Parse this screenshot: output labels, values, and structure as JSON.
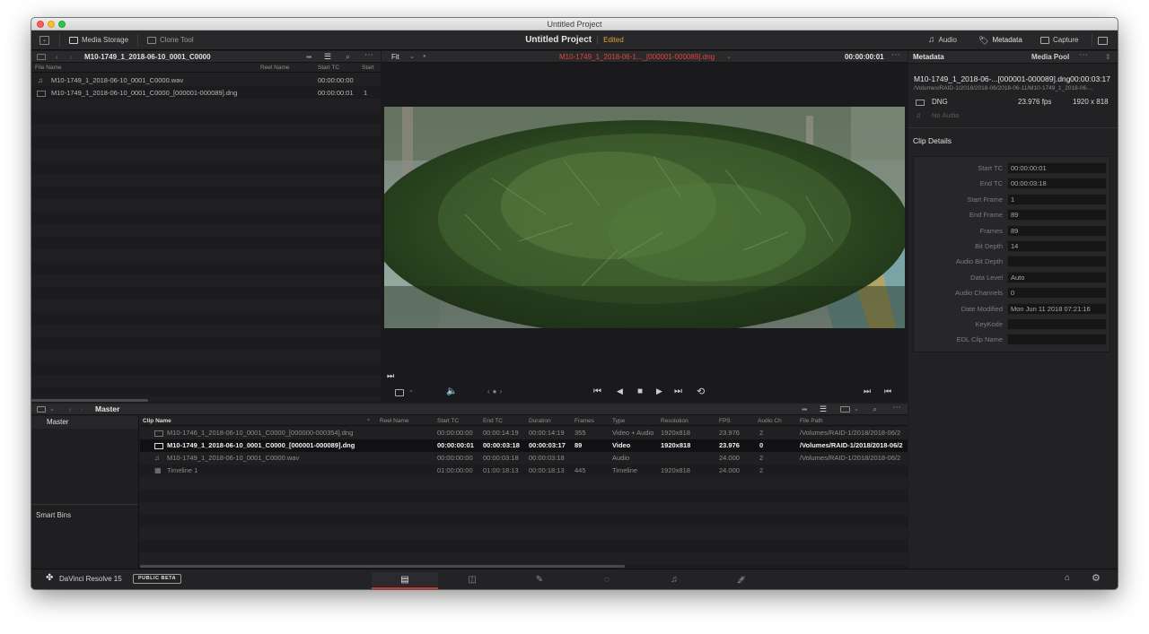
{
  "window": {
    "title": "Untitled Project"
  },
  "toolbar": {
    "media_storage": "Media Storage",
    "clone_tool": "Clone Tool",
    "project_name": "Untitled Project",
    "project_status": "Edited",
    "audio": "Audio",
    "metadata": "Metadata",
    "capture": "Capture"
  },
  "media_storage": {
    "path": "M10-1749_1_2018-06-10_0001_C0000",
    "columns": [
      "File Name",
      "Reel Name",
      "Start TC",
      "Start"
    ],
    "files": [
      {
        "icon": "audio-file-icon",
        "name": "M10-1749_1_2018-06-10_0001_C0000.wav",
        "reel": "",
        "start_tc": "00:00:00:00",
        "start": ""
      },
      {
        "icon": "video-file-icon",
        "name": "M10-1749_1_2018-06-10_0001_C0000_[000001-000089].dng",
        "reel": "",
        "start_tc": "00:00:00:01",
        "start": "1"
      }
    ]
  },
  "viewer": {
    "zoom": "Fit",
    "clip_name": "M10-1749_1_2018-06-1..._[000001-000089].dng",
    "timecode": "00:00:00:01",
    "accent_color": "#e0443a",
    "playhead_fraction": 0.0
  },
  "metadata_panel": {
    "tab_metadata": "Metadata",
    "tab_media_pool": "Media Pool",
    "clip_title": "M10-1749_1_2018-06-...[000001-000089].dng",
    "clip_duration": "00:00:03:17",
    "clip_path": "/Volumes/RAID-1/2018/2018-06/2018-06-11/M10-1749_1_2018-06-...",
    "format": "DNG",
    "fps": "23.976 fps",
    "resolution": "1920 x 818",
    "no_audio": "No Audio",
    "section": "Clip Details",
    "details": [
      {
        "key": "Start TC",
        "value": "00:00:00:01"
      },
      {
        "key": "End TC",
        "value": "00:00:03:18"
      },
      {
        "key": "Start Frame",
        "value": "1"
      },
      {
        "key": "End Frame",
        "value": "89"
      },
      {
        "key": "Frames",
        "value": "89"
      },
      {
        "key": "Bit Depth",
        "value": "14"
      },
      {
        "key": "Audio Bit Depth",
        "value": ""
      },
      {
        "key": "Data Level",
        "value": "Auto"
      },
      {
        "key": "Audio Channels",
        "value": "0"
      },
      {
        "key": "Date Modified",
        "value": "Mon Jun 11 2018 07:21:16"
      },
      {
        "key": "KeyKode",
        "value": ""
      },
      {
        "key": "EDL Clip Name",
        "value": ""
      }
    ]
  },
  "media_pool": {
    "current_bin": "Master",
    "bins": [
      "Master"
    ],
    "smart_bins": "Smart Bins",
    "columns": [
      "Clip Name",
      "Reel Name",
      "Start TC",
      "End TC",
      "Duration",
      "Frames",
      "Type",
      "Resolution",
      "FPS",
      "Audio Ch",
      "File Path"
    ],
    "clips": [
      {
        "icon": "video-file-icon",
        "name": "M10-1746_1_2018-06-10_0001_C0000_[000000-000354].dng",
        "reel": "",
        "start_tc": "00:00:00:00",
        "end_tc": "00:00:14:19",
        "duration": "00:00:14:19",
        "frames": "355",
        "type": "Video + Audio",
        "resolution": "1920x818",
        "fps": "23.976",
        "audio_ch": "2",
        "path": "/Volumes/RAID-1/2018/2018-06/2",
        "selected": false
      },
      {
        "icon": "video-file-icon",
        "name": "M10-1749_1_2018-06-10_0001_C0000_[000001-000089].dng",
        "reel": "",
        "start_tc": "00:00:00:01",
        "end_tc": "00:00:03:18",
        "duration": "00:00:03:17",
        "frames": "89",
        "type": "Video",
        "resolution": "1920x818",
        "fps": "23.976",
        "audio_ch": "0",
        "path": "/Volumes/RAID-1/2018/2018-06/2",
        "selected": true
      },
      {
        "icon": "audio-file-icon",
        "name": "M10-1749_1_2018-06-10_0001_C0000.wav",
        "reel": "",
        "start_tc": "00:00:00:00",
        "end_tc": "00:00:03:18",
        "duration": "00:00:03:18",
        "frames": "",
        "type": "Audio",
        "resolution": "",
        "fps": "24.000",
        "audio_ch": "2",
        "path": "/Volumes/RAID-1/2018/2018-06/2",
        "selected": false
      },
      {
        "icon": "timeline-icon",
        "name": "Timeline 1",
        "reel": "",
        "start_tc": "01:00:00:00",
        "end_tc": "01:00:18:13",
        "duration": "00:00:18:13",
        "frames": "445",
        "type": "Timeline",
        "resolution": "1920x818",
        "fps": "24.000",
        "audio_ch": "2",
        "path": "",
        "selected": false
      }
    ]
  },
  "bottom_bar": {
    "app_name": "DaVinci Resolve 15",
    "badge": "PUBLIC BETA",
    "pages": [
      "media-page-icon",
      "edit-page-icon",
      "fusion-page-icon",
      "color-page-icon",
      "fairlight-page-icon",
      "deliver-page-icon"
    ],
    "active_page": 0,
    "active_color": "#c7392f"
  }
}
